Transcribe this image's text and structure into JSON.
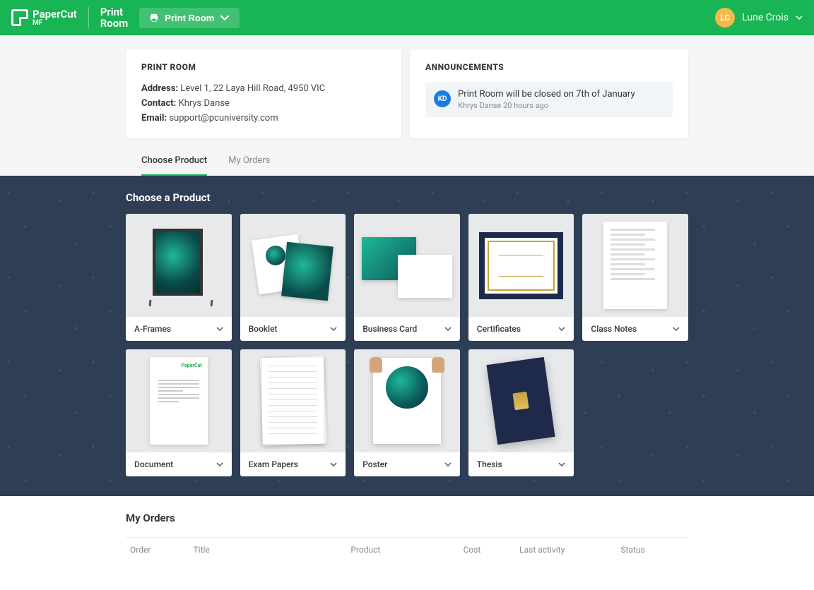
{
  "header": {
    "brand": "PaperCut",
    "brand_sub": "MF",
    "app_title_l1": "Print",
    "app_title_l2": "Room",
    "room_button": "Print Room",
    "user_initials": "LC",
    "user_name": "Lune Crois"
  },
  "room_card": {
    "title": "PRINT ROOM",
    "address_label": "Address:",
    "address_value": "Level 1, 22 Laya Hill Road, 4950 VIC",
    "contact_label": "Contact:",
    "contact_value": "Khrys Danse",
    "email_label": "Email:",
    "email_value": "support@pcuniversity.com"
  },
  "announcements": {
    "title": "ANNOUNCEMENTS",
    "item": {
      "avatar": "KD",
      "text": "Print Room will be closed on 7th of January",
      "author": "Khrys Danse",
      "time": "20 hours ago"
    }
  },
  "tabs": {
    "choose": "Choose Product",
    "orders": "My Orders"
  },
  "products": {
    "title": "Choose a Product",
    "items": [
      "A-Frames",
      "Booklet",
      "Business Card",
      "Certificates",
      "Class Notes",
      "Document",
      "Exam Papers",
      "Poster",
      "Thesis"
    ]
  },
  "orders": {
    "title": "My Orders",
    "columns": {
      "order": "Order",
      "title": "Title",
      "product": "Product",
      "cost": "Cost",
      "activity": "Last activity",
      "status": "Status"
    }
  },
  "colors": {
    "primary": "#19b453",
    "dark_bg": "#2d3e55",
    "avatar_user": "#f7b84b",
    "avatar_ann": "#1a7de0"
  }
}
